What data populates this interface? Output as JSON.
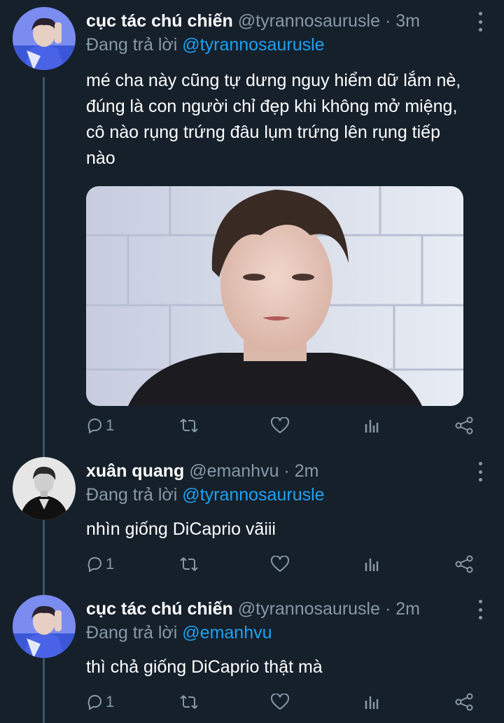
{
  "colors": {
    "background": "#15202b",
    "secondary_text": "#8899a6",
    "accent": "#1da1f2",
    "thread_line": "#3d5466"
  },
  "tweets": [
    {
      "name": "cục tác chú chiến",
      "handle": "@tyrannosaurusle",
      "dot": "·",
      "time": "3m",
      "reply_prefix": "Đang trả lời",
      "reply_mention": "@tyrannosaurusle",
      "text_lines": [
        "mé cha này cũng tự dưng nguy hiểm dữ lắm nè,",
        "đúng là con người chỉ đẹp khi không mở miệng,",
        "cô nào rụng trứng đâu lụm trứng lên rụng tiếp",
        "nào"
      ],
      "has_media": true,
      "reply_count": "1",
      "avatar_icon": "avatar-photo"
    },
    {
      "name": "xuân quang",
      "handle": "@emanhvu",
      "dot": "·",
      "time": "2m",
      "reply_prefix": "Đang trả lời",
      "reply_mention": "@tyrannosaurusle",
      "text": "nhìn giống DiCaprio vãiii",
      "reply_count": "1",
      "avatar_icon": "avatar-photo"
    },
    {
      "name": "cục tác chú chiến",
      "handle": "@tyrannosaurusle",
      "dot": "·",
      "time": "2m",
      "reply_prefix": "Đang trả lời",
      "reply_mention": "@emanhvu",
      "text": "thì chả giống DiCaprio thật mà",
      "reply_count": "1",
      "avatar_icon": "avatar-photo"
    }
  ],
  "action_icons": [
    "reply-icon",
    "retweet-icon",
    "like-icon",
    "analytics-icon",
    "share-icon"
  ]
}
